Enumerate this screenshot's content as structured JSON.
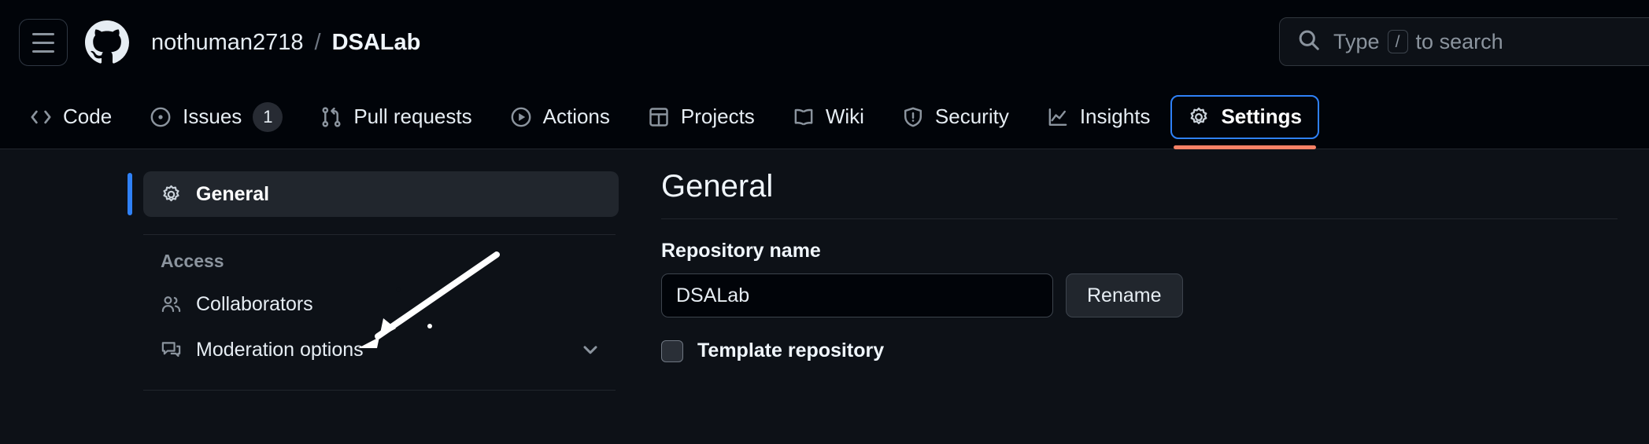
{
  "header": {
    "menu_icon": "hamburger-menu-icon",
    "logo_icon": "github-logo-icon",
    "owner": "nothuman2718",
    "separator": "/",
    "repo": "DSALab",
    "search": {
      "icon": "search-icon",
      "placeholder_prefix": "Type",
      "key_hint": "/",
      "placeholder_suffix": "to search"
    }
  },
  "nav": {
    "tabs": [
      {
        "label": "Code",
        "icon": "code-icon",
        "badge": null,
        "selected": false
      },
      {
        "label": "Issues",
        "icon": "issue-opened-icon",
        "badge": "1",
        "selected": false
      },
      {
        "label": "Pull requests",
        "icon": "git-pull-request-icon",
        "badge": null,
        "selected": false
      },
      {
        "label": "Actions",
        "icon": "play-icon",
        "badge": null,
        "selected": false
      },
      {
        "label": "Projects",
        "icon": "table-icon",
        "badge": null,
        "selected": false
      },
      {
        "label": "Wiki",
        "icon": "book-icon",
        "badge": null,
        "selected": false
      },
      {
        "label": "Security",
        "icon": "shield-icon",
        "badge": null,
        "selected": false
      },
      {
        "label": "Insights",
        "icon": "graph-icon",
        "badge": null,
        "selected": false
      },
      {
        "label": "Settings",
        "icon": "gear-icon",
        "badge": null,
        "selected": true
      }
    ]
  },
  "sidebar": {
    "general": {
      "label": "General",
      "icon": "gear-icon"
    },
    "access_label": "Access",
    "items": [
      {
        "label": "Collaborators",
        "icon": "people-icon",
        "chevron": false
      },
      {
        "label": "Moderation options",
        "icon": "comment-discussion-icon",
        "chevron": true
      }
    ]
  },
  "main": {
    "title": "General",
    "repo_name_label": "Repository name",
    "repo_name_value": "DSALab",
    "repo_name_placeholder": "Repository name",
    "rename_label": "Rename",
    "template_checkbox_label": "Template repository",
    "template_checked": false
  },
  "colors": {
    "page_bg": "#010409",
    "body_bg": "#0d1117",
    "accent_blue": "#2f81f7",
    "active_underline": "#f78166",
    "border": "#21262d",
    "muted_text": "#8b949e",
    "text": "#e6edf3"
  },
  "annotation": {
    "arrow": "pointer-arrow-to-collaborators"
  }
}
